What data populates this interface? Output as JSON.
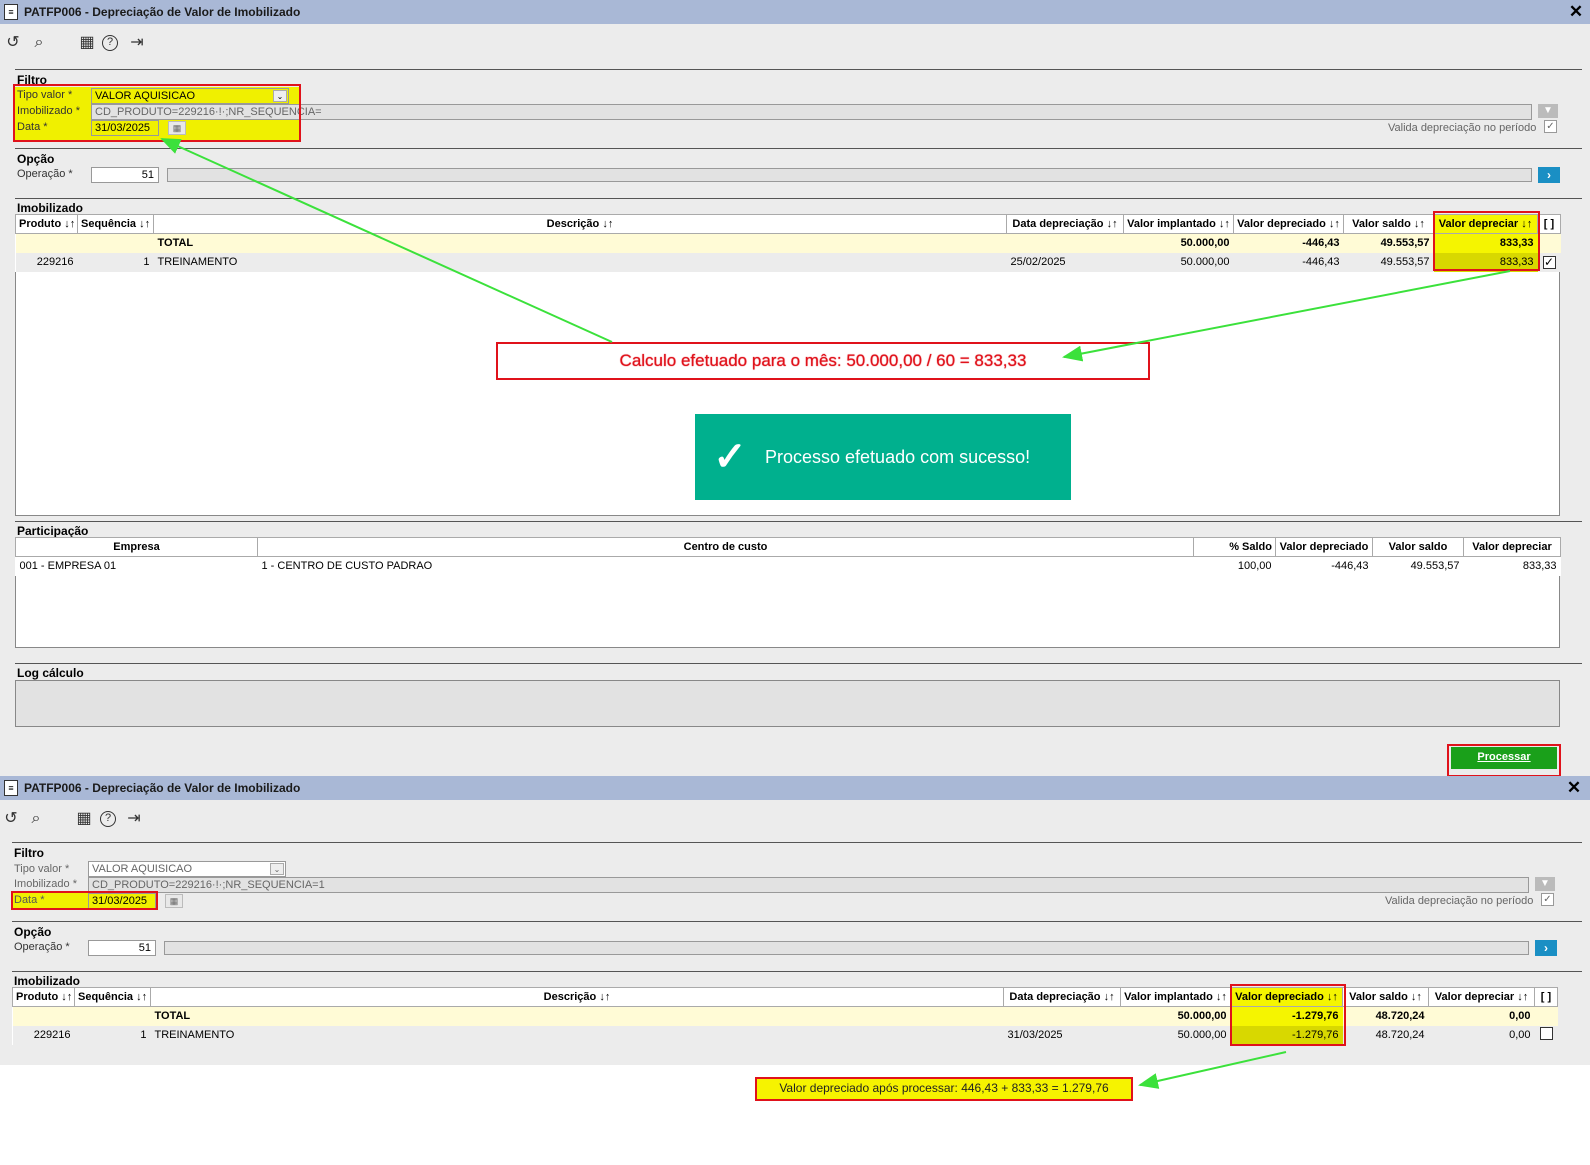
{
  "window_title": "PATFP006 - Depreciação de Valor de Imobilizado",
  "toolbar": {
    "refresh": "↺",
    "search": "⌕",
    "calendar": "▦",
    "help": "?",
    "exit": "⇥"
  },
  "filtro": {
    "title": "Filtro",
    "tipo_valor_label": "Tipo valor *",
    "tipo_valor_value": "VALOR AQUISICAO",
    "imobilizado_label": "Imobilizado *",
    "imobilizado_value_1": "CD_PRODUTO=229216·!·;NR_SEQUENCIA=",
    "imobilizado_value_2": "CD_PRODUTO=229216·!·;NR_SEQUENCIA=1",
    "data_label": "Data *",
    "data_value": "31/03/2025",
    "valida_label": "Valida depreciação no período"
  },
  "opcao": {
    "title": "Opção",
    "operacao_label": "Operação *",
    "operacao_value": "51"
  },
  "imobilizado_table": {
    "title": "Imobilizado",
    "headers": [
      "Produto ↓↑",
      "Sequência ↓↑",
      "Descrição ↓↑",
      "Data depreciação ↓↑",
      "Valor implantado ↓↑",
      "Valor depreciado ↓↑",
      "Valor saldo ↓↑",
      "Valor depreciar ↓↑",
      "[ ]"
    ],
    "total_label": "TOTAL",
    "before": {
      "total": {
        "implantado": "50.000,00",
        "depreciado": "-446,43",
        "saldo": "49.553,57",
        "depreciar": "833,33"
      },
      "row": {
        "produto": "229216",
        "sequencia": "1",
        "descricao": "TREINAMENTO",
        "data": "25/02/2025",
        "implantado": "50.000,00",
        "depreciado": "-446,43",
        "saldo": "49.553,57",
        "depreciar": "833,33"
      }
    },
    "after": {
      "total": {
        "implantado": "50.000,00",
        "depreciado": "-1.279,76",
        "saldo": "48.720,24",
        "depreciar": "0,00"
      },
      "row": {
        "produto": "229216",
        "sequencia": "1",
        "descricao": "TREINAMENTO",
        "data": "31/03/2025",
        "implantado": "50.000,00",
        "depreciado": "-1.279,76",
        "saldo": "48.720,24",
        "depreciar": "0,00"
      }
    }
  },
  "participacao": {
    "title": "Participação",
    "headers": [
      "Empresa",
      "Centro de custo",
      "% Saldo",
      "Valor depreciado",
      "Valor saldo",
      "Valor depreciar"
    ],
    "row": {
      "empresa": "001 - EMPRESA 01",
      "centro": "1 - CENTRO DE CUSTO PADRAO",
      "pct": "100,00",
      "depreciado": "-446,43",
      "saldo": "49.553,57",
      "depreciar": "833,33"
    }
  },
  "log": {
    "title": "Log cálculo"
  },
  "processar_label": "Processar",
  "annotation_calc": "Calculo efetuado para o mês:  50.000,00 / 60 = 833,33",
  "toast_message": "Processo efetuado com sucesso!",
  "annotation_after": "Valor depreciado após processar: 446,43 + 833,33 =  1.279,76",
  "colors": {
    "highlight": "#f5f500",
    "annotation_red": "#e0121b",
    "toast_green": "#00b08e",
    "process_button": "#1aa01a",
    "titlebar": "#a9b8d6"
  }
}
